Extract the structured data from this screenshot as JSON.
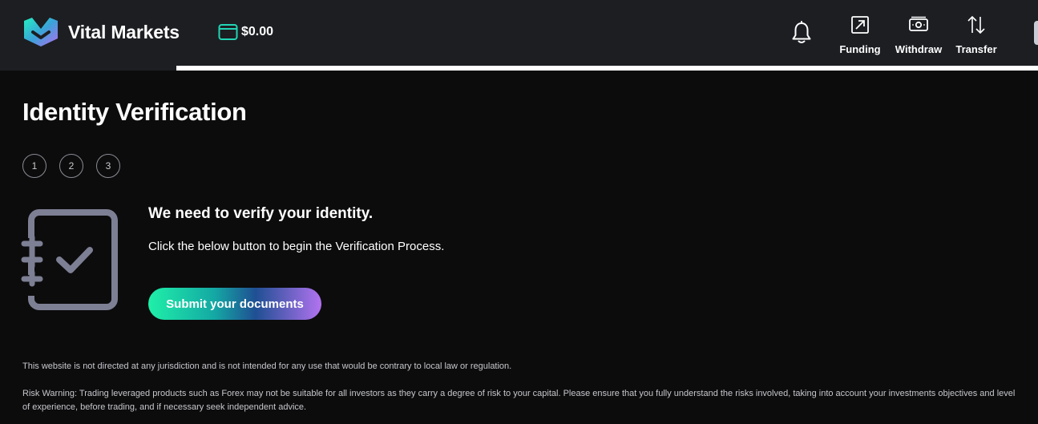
{
  "header": {
    "brand_name": "Vital Markets",
    "wallet_balance": "$0.00",
    "actions": [
      {
        "label": "Funding",
        "icon": "arrow-up-right-box-icon"
      },
      {
        "label": "Withdraw",
        "icon": "cash-icon"
      },
      {
        "label": "Transfer",
        "icon": "transfer-arrows-icon"
      }
    ],
    "notification_icon": "bell-icon",
    "load_progress": 0.17
  },
  "colors": {
    "header_bg": "#1c1e22",
    "page_bg": "#0c0c0d",
    "accent_green": "#1ff0a8",
    "accent_purple": "#b273f0",
    "icon_gray": "#7d7f94"
  },
  "main": {
    "title": "Identity Verification",
    "steps": [
      "1",
      "2",
      "3"
    ],
    "heading": "We need to verify your identity.",
    "description": "Click the below button to begin the Verification Process.",
    "submit_label": "Submit your documents"
  },
  "footer": {
    "disclaimer": "This website is not directed at any jurisdiction and is not intended for any use that would be contrary to local law or regulation.",
    "risk_warning": "Risk Warning: Trading leveraged products such as Forex may not be suitable for all investors as they carry a degree of risk to your capital. Please ensure that you fully understand the risks involved, taking into account your investments objectives and level of experience, before trading, and if necessary seek independent advice."
  }
}
